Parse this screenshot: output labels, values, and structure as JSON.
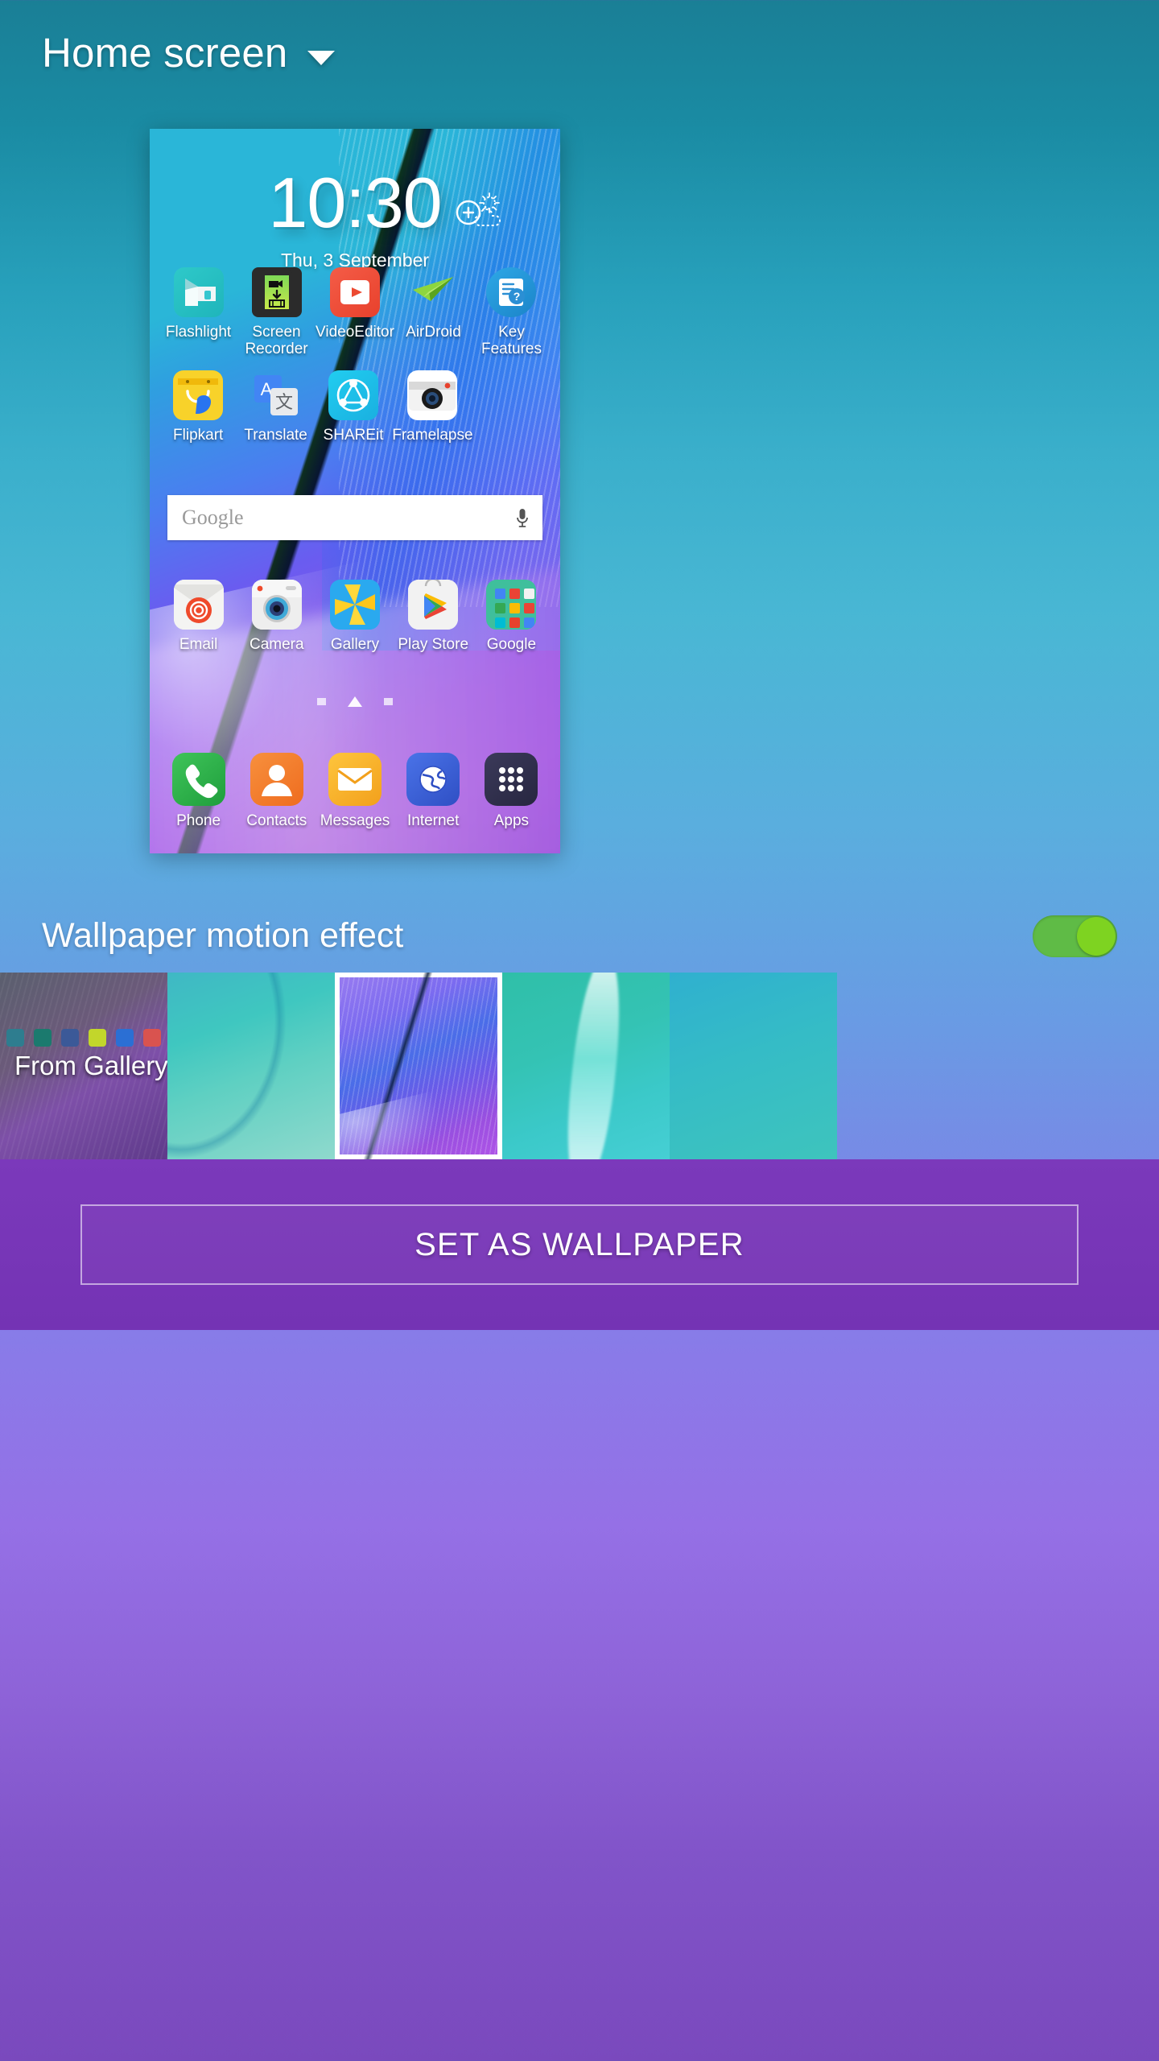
{
  "header": {
    "title": "Home screen",
    "dropdown_icon": "chevron-down-icon"
  },
  "preview": {
    "clock_time": "10:30",
    "clock_date": "Thu, 3 September",
    "weather_icon": "weather-add-icon",
    "search": {
      "placeholder": "Google",
      "mic_icon": "microphone-icon"
    },
    "page_indicator": {
      "pages": 3,
      "current": 2
    },
    "rows": [
      [
        {
          "label": "Flashlight",
          "icon": "flashlight-icon"
        },
        {
          "label": "Screen Recorder",
          "icon": "screen-recorder-icon"
        },
        {
          "label": "VideoEditor",
          "icon": "video-editor-icon"
        },
        {
          "label": "AirDroid",
          "icon": "airdroid-icon"
        },
        {
          "label": "Key Features",
          "icon": "key-features-icon"
        }
      ],
      [
        {
          "label": "Flipkart",
          "icon": "flipkart-icon"
        },
        {
          "label": "Translate",
          "icon": "translate-icon"
        },
        {
          "label": "SHAREit",
          "icon": "shareit-icon"
        },
        {
          "label": "Framelapse",
          "icon": "framelapse-icon"
        },
        {
          "label": "",
          "icon": ""
        }
      ],
      [
        {
          "label": "Email",
          "icon": "email-icon"
        },
        {
          "label": "Camera",
          "icon": "camera-icon"
        },
        {
          "label": "Gallery",
          "icon": "gallery-icon"
        },
        {
          "label": "Play Store",
          "icon": "play-store-icon"
        },
        {
          "label": "Google",
          "icon": "google-folder-icon"
        }
      ]
    ],
    "dock": [
      {
        "label": "Phone",
        "icon": "phone-icon"
      },
      {
        "label": "Contacts",
        "icon": "contacts-icon"
      },
      {
        "label": "Messages",
        "icon": "messages-icon"
      },
      {
        "label": "Internet",
        "icon": "internet-icon"
      },
      {
        "label": "Apps",
        "icon": "apps-grid-icon"
      }
    ]
  },
  "edit_fab": {
    "icon": "pencil-icon"
  },
  "motion_effect": {
    "label": "Wallpaper motion effect",
    "toggle_state": "on",
    "toggle_color": "#7ed321"
  },
  "thumbnails": {
    "gallery_label": "From Gallery",
    "selected_index": 2,
    "items": [
      {
        "name": "from-gallery"
      },
      {
        "name": "wallpaper-teal-curve"
      },
      {
        "name": "wallpaper-note5-blue-purple"
      },
      {
        "name": "wallpaper-water-drop"
      },
      {
        "name": "wallpaper-teal-gradient"
      }
    ]
  },
  "bottom_action": {
    "label": "SET AS WALLPAPER"
  }
}
